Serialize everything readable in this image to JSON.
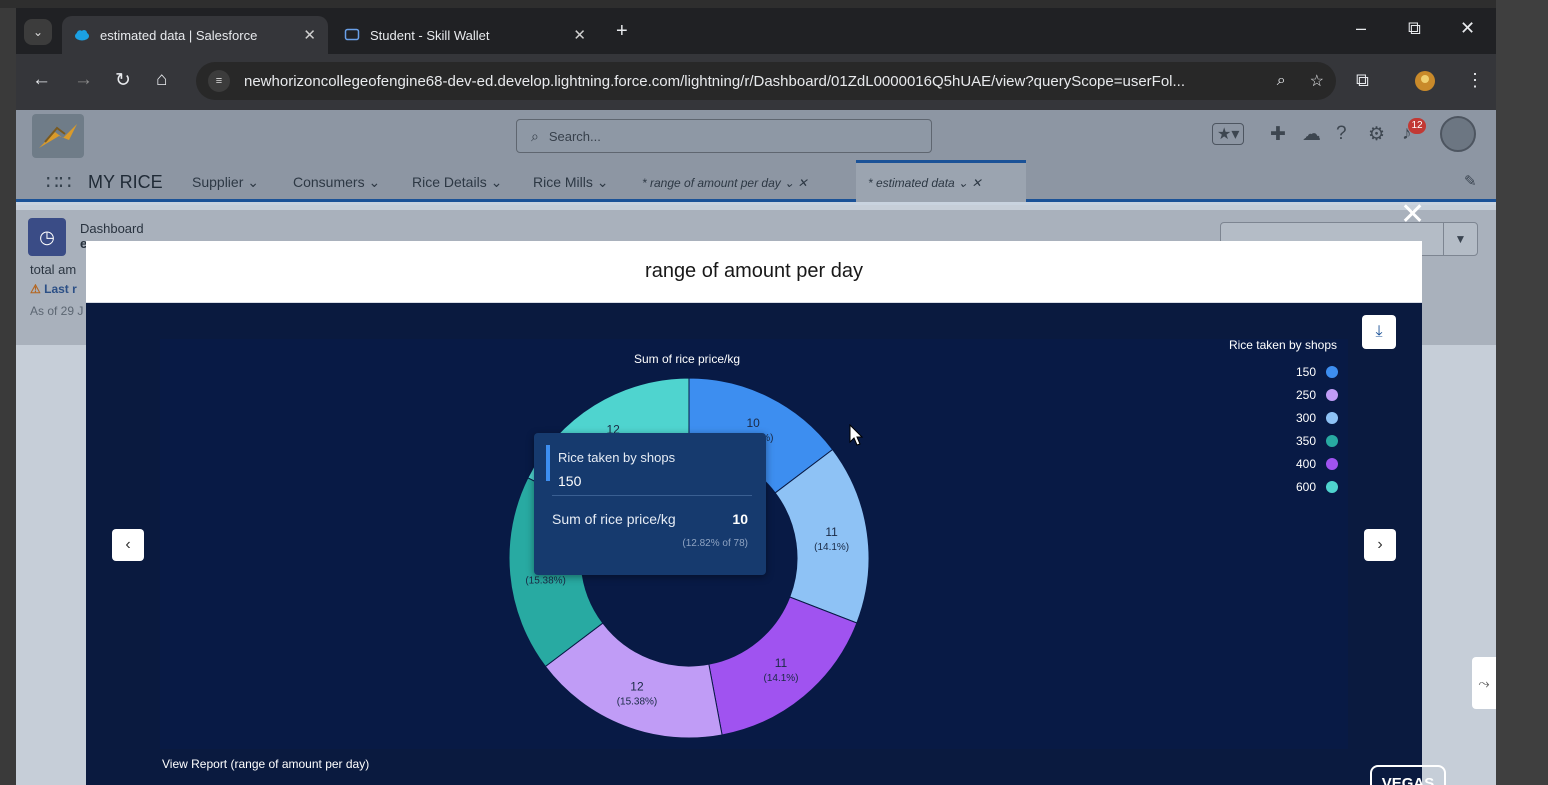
{
  "browser": {
    "tabs": [
      {
        "title": "estimated data | Salesforce",
        "active": true
      },
      {
        "title": "Student - Skill Wallet",
        "active": false
      }
    ],
    "url": "newhorizoncollegeofengine68-dev-ed.develop.lightning.force.com/lightning/r/Dashboard/01ZdL0000016Q5hUAE/view?queryScope=userFol...",
    "icons": {
      "tab_menu": "chevron-down-icon",
      "new_tab": "plus-icon",
      "back": "back-arrow-icon",
      "forward": "forward-arrow-icon",
      "reload": "reload-icon",
      "home": "home-icon",
      "site_info": "tune-icon",
      "zoom": "zoom-icon",
      "bookmark": "star-icon",
      "extensions": "puzzle-icon",
      "profile": "profile-icon",
      "menu": "kebab-icon"
    }
  },
  "salesforce": {
    "search_placeholder": "Search...",
    "notification_count": "12",
    "app_name": "MY RICE",
    "nav": [
      {
        "label": "Supplier"
      },
      {
        "label": "Consumers"
      },
      {
        "label": "Rice Details"
      },
      {
        "label": "Rice Mills"
      },
      {
        "label": "* range of amount per day"
      },
      {
        "label": "* estimated data"
      }
    ],
    "dashboard": {
      "type_label": "Dashboard",
      "title_fragment": "e",
      "total_fragment": "total am",
      "warning_fragment": "Last r",
      "asof_fragment": "As of 29 J"
    }
  },
  "modal": {
    "title": "range of amount per day",
    "view_report": "View Report (range of amount per day)",
    "watermark": "VEGAS"
  },
  "tooltip": {
    "dimension_label": "Rice taken by shops",
    "dimension_value": "150",
    "measure_label": "Sum of rice price/kg",
    "measure_value": "10",
    "percent_text": "(12.82% of 78)"
  },
  "colors": {
    "c150": "#3d8ef0",
    "c250": "#c09cf6",
    "c300": "#8ec2f5",
    "c350": "#28aaa2",
    "c400": "#a053f0",
    "c600": "#4fd4cf",
    "panel": "#081a45",
    "modal_bg": "#0a1a3f"
  },
  "chart_data": {
    "type": "pie",
    "title": "Sum of rice price/kg",
    "legend_title": "Rice taken by shops",
    "legend_position": "top-right",
    "total": 78,
    "categories": [
      "150",
      "250",
      "300",
      "350",
      "400",
      "600"
    ],
    "values": [
      10,
      12,
      11,
      12,
      11,
      12
    ],
    "percent_labels": [
      "(12.82%)",
      "(15.38%)",
      "(14.1%)",
      "(15.38%)",
      "(14.1%)",
      "(15.38%)"
    ],
    "slice_order": [
      "150",
      "300",
      "400",
      "250",
      "350",
      "600"
    ],
    "donut": true
  }
}
